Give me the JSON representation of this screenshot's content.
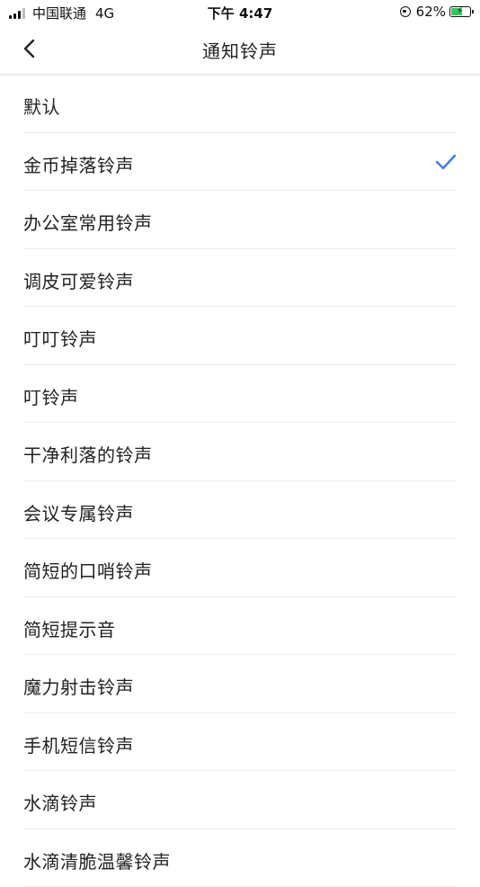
{
  "status_bar": {
    "carrier": "中国联通",
    "network": "4G",
    "time": "下午 4:47",
    "battery_percent": "62%",
    "battery_level": 0.62,
    "signal_bars_on": 3,
    "signal_bars_total": 4
  },
  "nav": {
    "back_icon": "chevron-left-icon",
    "title": "通知铃声"
  },
  "colors": {
    "accent": "#3a7bf5",
    "battery_green": "#34c759"
  },
  "ringtones": [
    {
      "label": "默认",
      "selected": false
    },
    {
      "label": "金币掉落铃声",
      "selected": true
    },
    {
      "label": "办公室常用铃声",
      "selected": false
    },
    {
      "label": "调皮可爱铃声",
      "selected": false
    },
    {
      "label": "叮叮铃声",
      "selected": false
    },
    {
      "label": "叮铃声",
      "selected": false
    },
    {
      "label": "干净利落的铃声",
      "selected": false
    },
    {
      "label": "会议专属铃声",
      "selected": false
    },
    {
      "label": "简短的口哨铃声",
      "selected": false
    },
    {
      "label": "简短提示音",
      "selected": false
    },
    {
      "label": "魔力射击铃声",
      "selected": false
    },
    {
      "label": "手机短信铃声",
      "selected": false
    },
    {
      "label": "水滴铃声",
      "selected": false
    },
    {
      "label": "水滴清脆温馨铃声",
      "selected": false
    }
  ]
}
